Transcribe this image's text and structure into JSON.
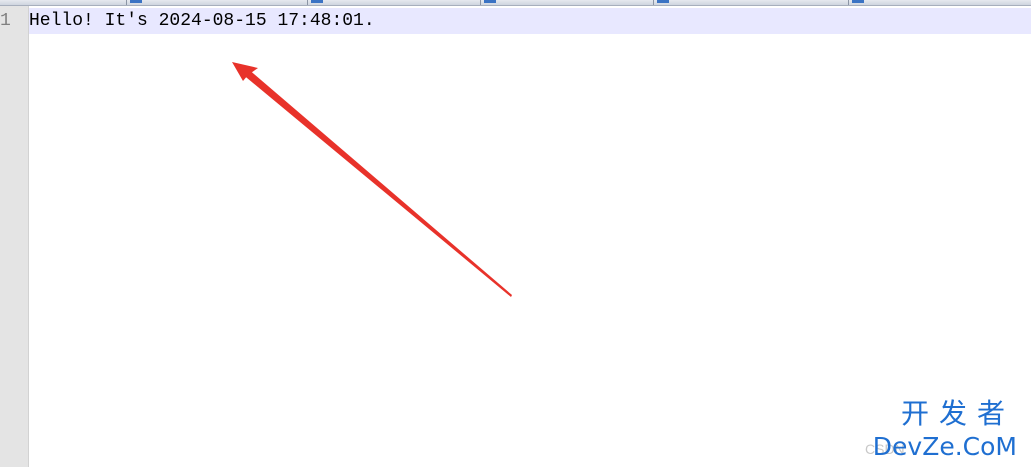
{
  "editor": {
    "line_number": "1",
    "code_line": "Hello! It's 2024-08-15 17:48:01."
  },
  "annotation": {
    "arrow_color": "#e8322a"
  },
  "watermark": {
    "top_text": "开发者",
    "bottom_text": "DevZe.CoM",
    "ghost_text": "CSDN",
    "color": "#1f6fd1"
  }
}
